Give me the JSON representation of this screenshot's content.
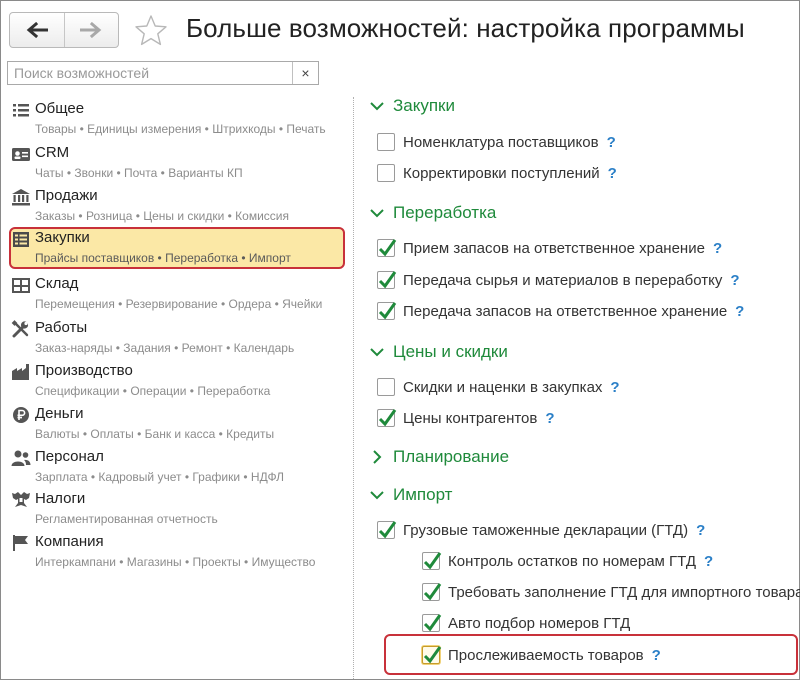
{
  "header": {
    "back_icon": "arrow-left-icon",
    "forward_icon": "arrow-right-icon",
    "favorite_icon": "star-outline-icon",
    "title": "Больше возможностей: настройка программы"
  },
  "search": {
    "placeholder": "Поиск возможностей",
    "value": "",
    "clear_label": "×"
  },
  "sidebar": {
    "items": [
      {
        "label": "Общее",
        "sub": "Товары • Единицы измерения • Штрихкоды • Печать",
        "icon": "list-icon"
      },
      {
        "label": "CRM",
        "sub": "Чаты • Звонки • Почта • Варианты КП",
        "icon": "contact-card-icon"
      },
      {
        "label": "Продажи",
        "sub": "Заказы • Розница • Цены и скидки • Комиссия",
        "icon": "store-icon"
      },
      {
        "label": "Закупки",
        "sub": "Прайсы поставщиков • Переработка • Импорт",
        "icon": "purchase-list-icon",
        "selected": true
      },
      {
        "label": "Склад",
        "sub": "Перемещения • Резервирование • Ордера • Ячейки",
        "icon": "warehouse-icon"
      },
      {
        "label": "Работы",
        "sub": "Заказ-наряды • Задания • Ремонт • Календарь",
        "icon": "tools-icon"
      },
      {
        "label": "Производство",
        "sub": "Спецификации • Операции • Переработка",
        "icon": "factory-icon"
      },
      {
        "label": "Деньги",
        "sub": "Валюты • Оплаты • Банк и касса • Кредиты",
        "icon": "ruble-coin-icon"
      },
      {
        "label": "Персонал",
        "sub": "Зарплата • Кадровый учет • Графики • НДФЛ",
        "icon": "people-icon"
      },
      {
        "label": "Налоги",
        "sub": "Регламентированная отчетность",
        "icon": "eagle-emblem-icon"
      },
      {
        "label": "Компания",
        "sub": "Интеркампани • Магазины • Проекты • Имущество",
        "icon": "flag-icon"
      }
    ]
  },
  "sections": [
    {
      "label": "Закупки",
      "expanded": true,
      "options": [
        {
          "label": "Номенклатура поставщиков",
          "checked": false
        },
        {
          "label": "Корректировки поступлений",
          "checked": false
        }
      ]
    },
    {
      "label": "Переработка",
      "expanded": true,
      "options": [
        {
          "label": "Прием запасов на ответственное хранение",
          "checked": true
        },
        {
          "label": "Передача сырья и материалов в переработку",
          "checked": true
        },
        {
          "label": "Передача запасов на ответственное хранение",
          "checked": true
        }
      ]
    },
    {
      "label": "Цены и скидки",
      "expanded": true,
      "options": [
        {
          "label": "Скидки и наценки в закупках",
          "checked": false
        },
        {
          "label": "Цены контрагентов",
          "checked": true
        }
      ]
    },
    {
      "label": "Планирование",
      "expanded": false,
      "options": []
    },
    {
      "label": "Импорт",
      "expanded": true,
      "options": [
        {
          "label": "Грузовые таможенные декларации (ГТД)",
          "checked": true
        },
        {
          "label": "Контроль остатков по номерам ГТД",
          "checked": true
        },
        {
          "label": "Требовать заполнение ГТД для импортного товара",
          "checked": true
        },
        {
          "label": "Авто подбор номеров ГТД",
          "checked": true,
          "help": false
        },
        {
          "label": "Прослеживаемость товаров",
          "checked": true,
          "focused": true
        }
      ]
    }
  ],
  "help_mark": "?",
  "colors": {
    "section_green": "#1f8a3b",
    "check_green": "#1f8a3b",
    "help_blue": "#2a7fc7",
    "selection_fill": "#fbe8a6",
    "highlight_red": "#c8313a"
  }
}
